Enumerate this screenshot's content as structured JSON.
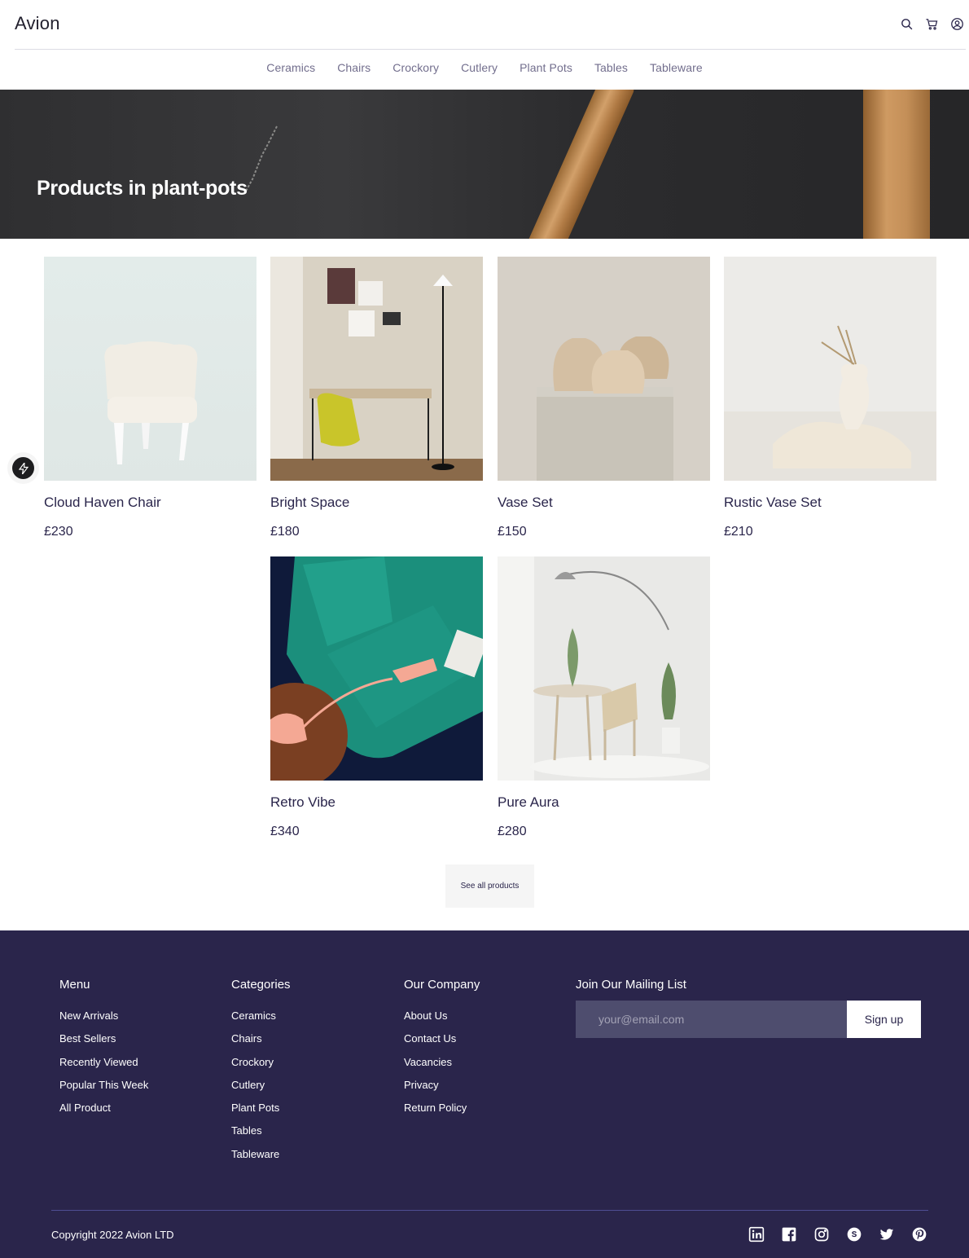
{
  "header": {
    "logo": "Avion",
    "nav": [
      "Ceramics",
      "Chairs",
      "Crockory",
      "Cutlery",
      "Plant Pots",
      "Tables",
      "Tableware"
    ],
    "icons": [
      "search-icon",
      "cart-icon",
      "user-icon"
    ]
  },
  "hero": {
    "title": "Products in plant-pots"
  },
  "products": [
    {
      "name": "Cloud Haven Chair",
      "price": "£230"
    },
    {
      "name": "Bright Space",
      "price": "£180"
    },
    {
      "name": "Vase Set",
      "price": "£150"
    },
    {
      "name": "Rustic Vase Set",
      "price": "£210"
    },
    {
      "name": "Retro Vibe",
      "price": "£340"
    },
    {
      "name": "Pure Aura",
      "price": "£280"
    }
  ],
  "see_all_label": "See all products",
  "footer": {
    "menu": {
      "title": "Menu",
      "links": [
        "New Arrivals",
        "Best Sellers",
        "Recently Viewed",
        "Popular This Week",
        "All Product"
      ]
    },
    "categories": {
      "title": "Categories",
      "links": [
        "Ceramics",
        "Chairs",
        "Crockory",
        "Cutlery",
        "Plant Pots",
        "Tables",
        "Tableware"
      ]
    },
    "company": {
      "title": "Our Company",
      "links": [
        "About Us",
        "Contact Us",
        "Vacancies",
        "Privacy",
        "Return Policy"
      ]
    },
    "mailing": {
      "title": "Join Our Mailing List",
      "placeholder": "your@email.com",
      "button": "Sign up"
    },
    "copyright": "Copyright 2022 Avion LTD",
    "socials": [
      "linkedin-icon",
      "facebook-icon",
      "instagram-icon",
      "skype-icon",
      "twitter-icon",
      "pinterest-icon"
    ]
  },
  "colors": {
    "brand_dark": "#2A254B",
    "nav_text": "#726E8D",
    "input_bg": "#4E4D6E"
  }
}
